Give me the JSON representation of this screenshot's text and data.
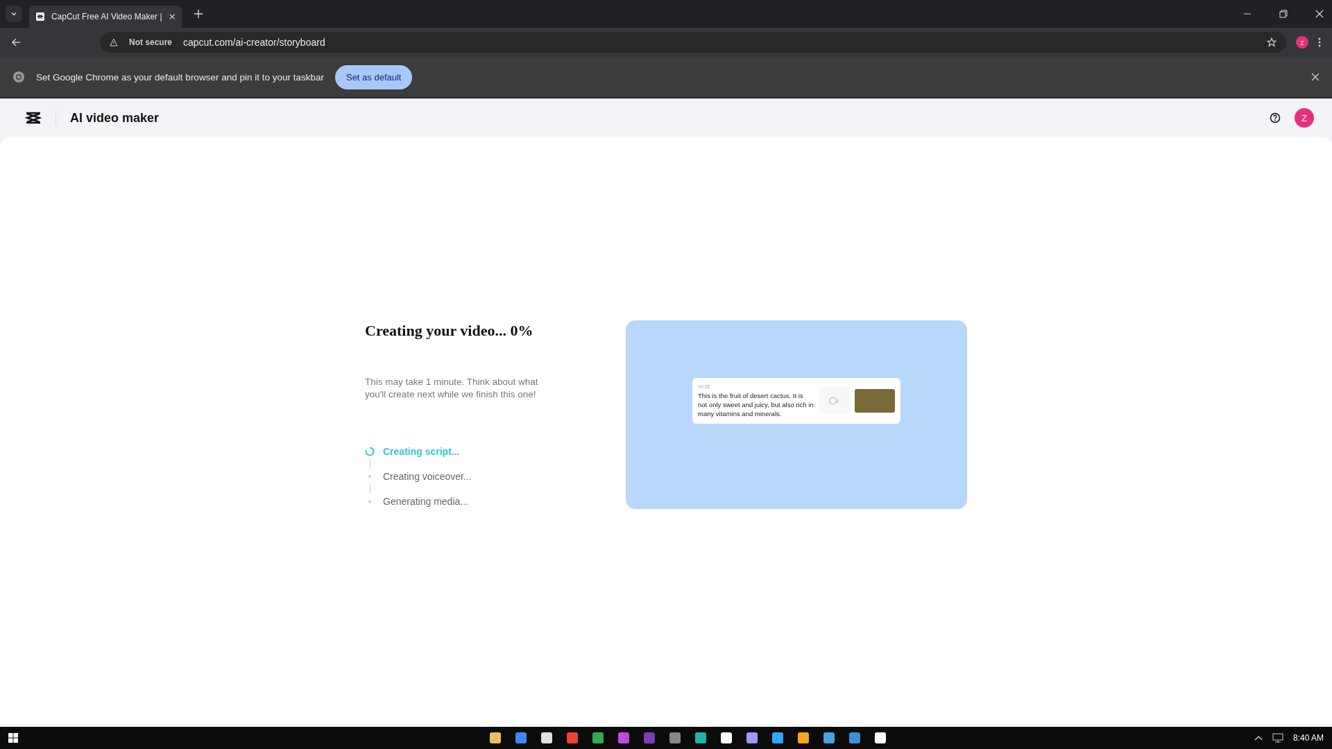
{
  "browser": {
    "tab_title": "CapCut Free AI Video Maker |",
    "security": "Not secure",
    "url": "capcut.com/ai-creator/storyboard",
    "profile_initial": "z"
  },
  "infobar": {
    "message": "Set Google Chrome as your default browser and pin it to your taskbar",
    "button": "Set as default"
  },
  "app": {
    "title": "AI video maker",
    "avatar_initial": "Z"
  },
  "progress": {
    "title": "Creating your video... 0%",
    "subtitle": "This may take 1 minute. Think about what you'll create next while we finish this one!",
    "steps": [
      {
        "label": "Creating script...",
        "active": true
      },
      {
        "label": "Creating voiceover...",
        "active": false
      },
      {
        "label": "Generating media...",
        "active": false
      }
    ]
  },
  "preview": {
    "timestamp": "00:05",
    "caption": "This is the fruit of desert cactus. It is not only sweet and juicy, but also rich in many vitamins and minerals."
  },
  "taskbar": {
    "time": "8:40 AM"
  }
}
